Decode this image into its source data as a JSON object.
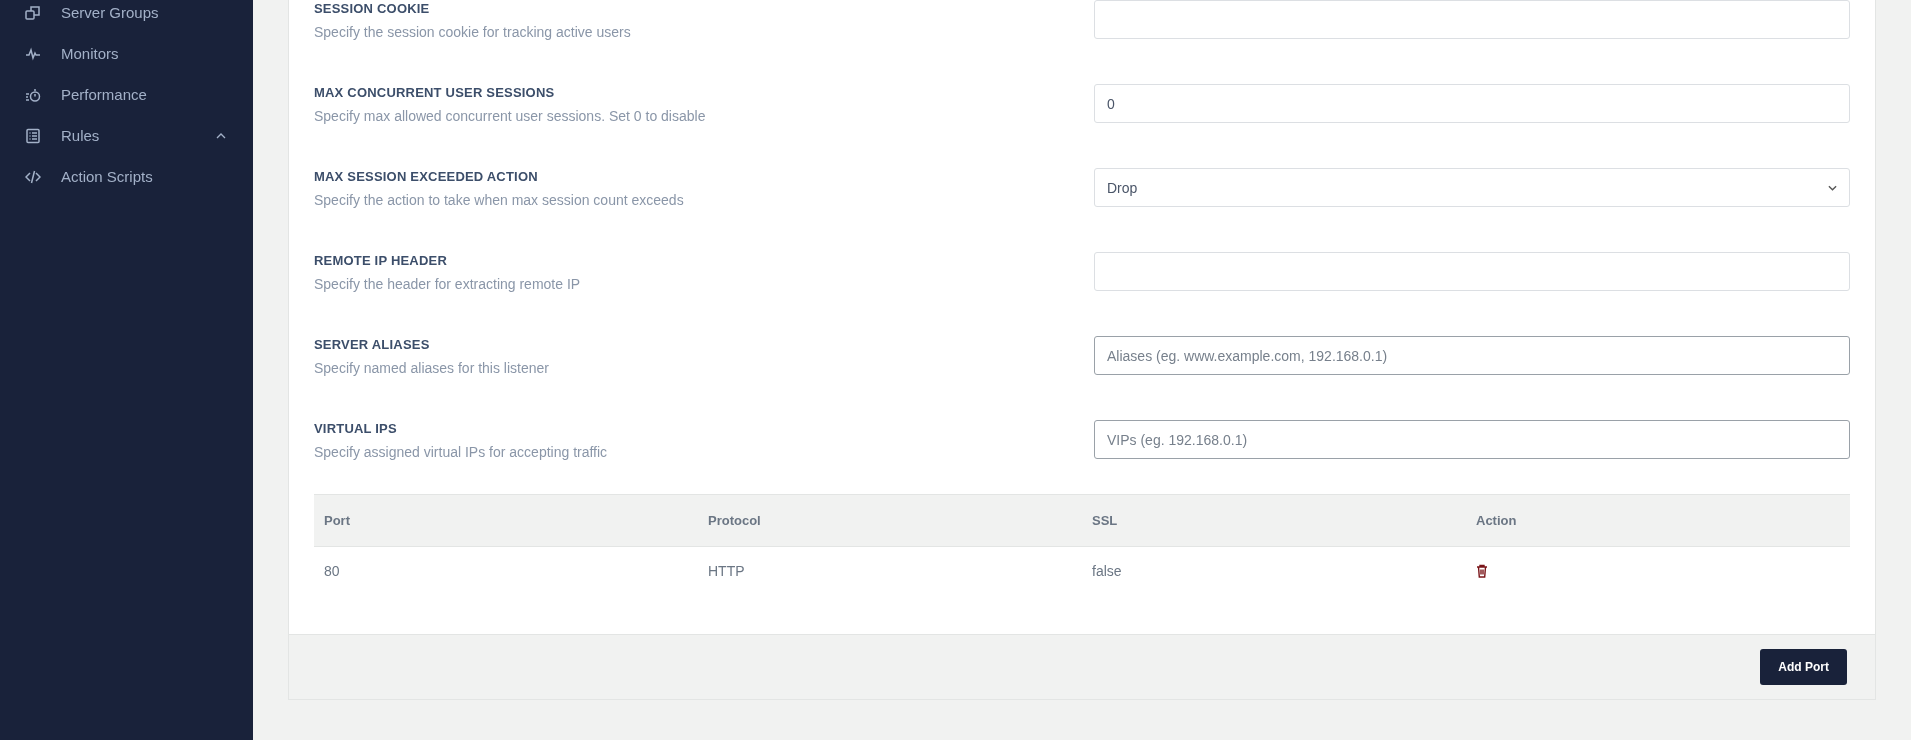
{
  "sidebar": {
    "items": [
      {
        "label": "Server Groups"
      },
      {
        "label": "Monitors"
      },
      {
        "label": "Performance"
      },
      {
        "label": "Rules",
        "expanded": true
      },
      {
        "label": "Action Scripts"
      }
    ]
  },
  "form": {
    "fields": [
      {
        "kind": "input",
        "label": "SESSION COOKIE",
        "description": "Specify the session cookie for tracking active users"
      },
      {
        "kind": "input",
        "label": "MAX CONCURRENT USER SESSIONS",
        "description": "Specify max allowed concurrent user sessions. Set 0 to disable",
        "value": "0"
      },
      {
        "kind": "select",
        "label": "MAX SESSION EXCEEDED ACTION",
        "description": "Specify the action to take when max session count exceeds",
        "value": "Drop"
      },
      {
        "kind": "input",
        "label": "REMOTE IP HEADER",
        "description": "Specify the header for extracting remote IP"
      },
      {
        "kind": "tags",
        "label": "SERVER ALIASES",
        "description": "Specify named aliases for this listener",
        "placeholder": "Aliases (eg. www.example.com, 192.168.0.1)"
      },
      {
        "kind": "tags",
        "label": "VIRTUAL IPS",
        "description": "Specify assigned virtual IPs for accepting traffic",
        "placeholder": "VIPs (eg. 192.168.0.1)"
      }
    ]
  },
  "ports_table": {
    "columns": [
      "Port",
      "Protocol",
      "SSL",
      "Action"
    ],
    "rows": [
      {
        "port": "80",
        "protocol": "HTTP",
        "ssl": "false"
      }
    ]
  },
  "footer": {
    "button": "Add Port"
  }
}
